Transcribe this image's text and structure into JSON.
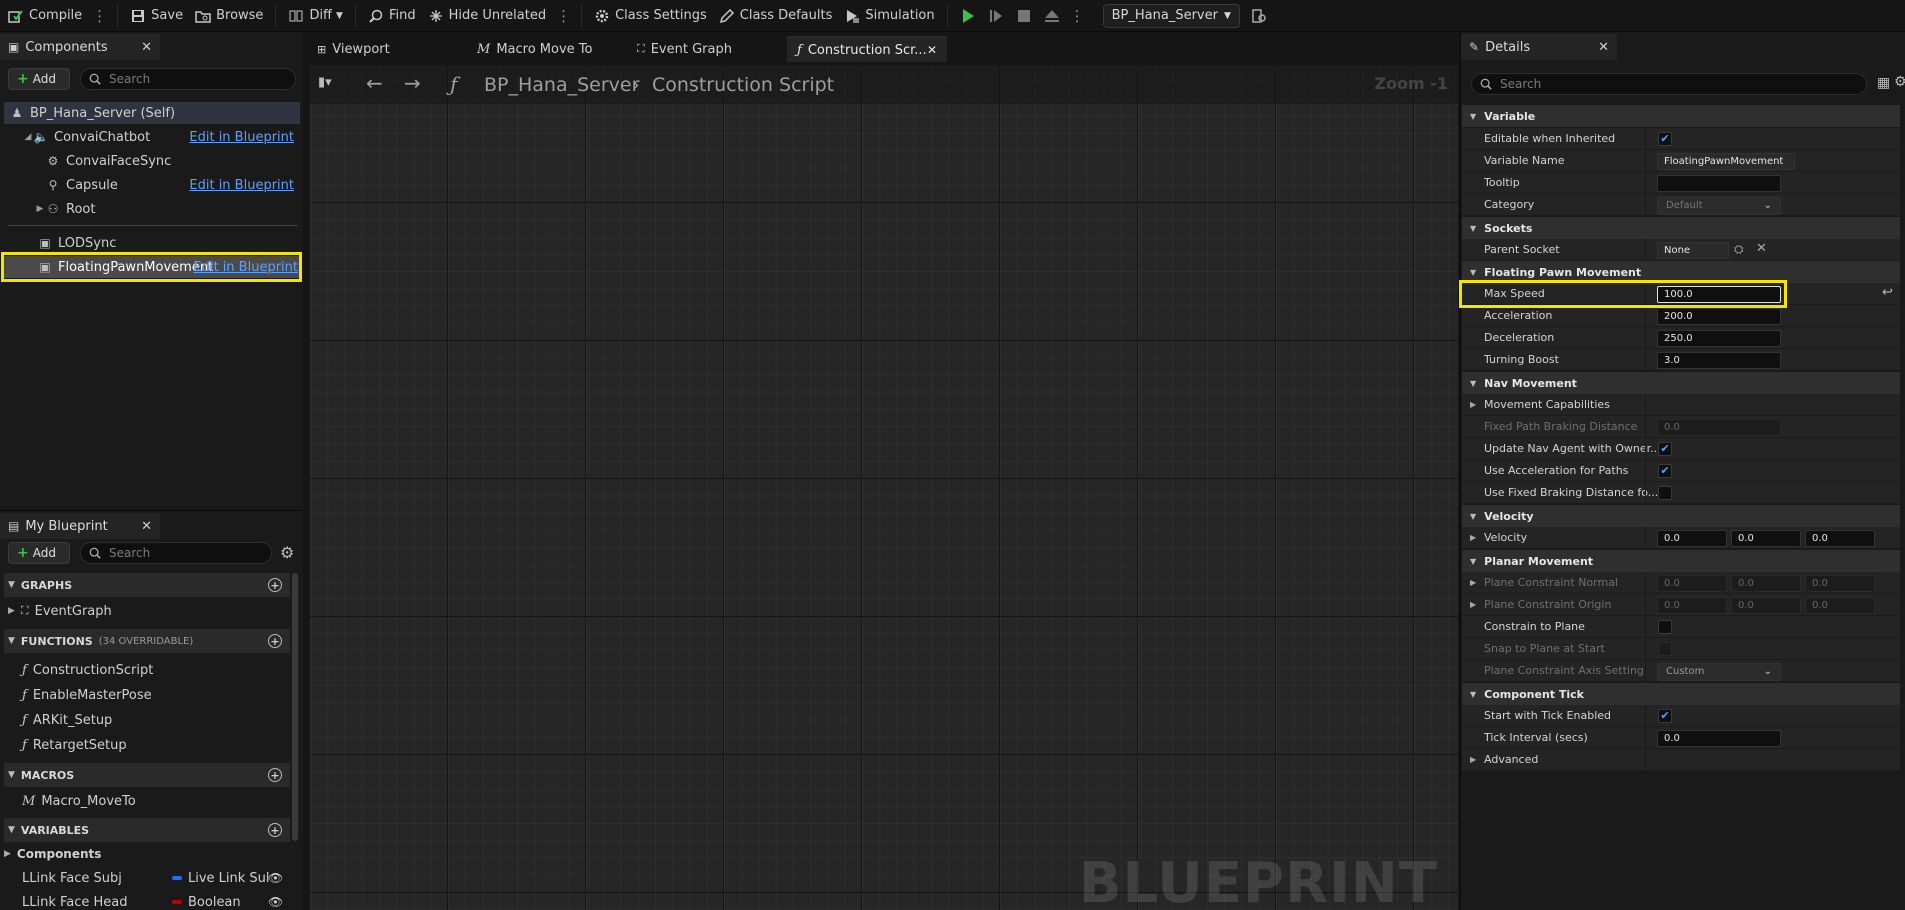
{
  "toolbar": {
    "compile": "Compile",
    "save": "Save",
    "browse": "Browse",
    "diff": "Diff",
    "find": "Find",
    "hide_unrelated": "Hide Unrelated",
    "class_settings": "Class Settings",
    "class_defaults": "Class Defaults",
    "simulation": "Simulation",
    "debug_object": "BP_Hana_Server"
  },
  "components": {
    "tab_title": "Components",
    "add_label": "Add",
    "search_placeholder": "Search",
    "edit_in_blueprint": "Edit in Blueprint",
    "items": [
      {
        "label": "BP_Hana_Server (Self)"
      },
      {
        "label": "ConvaiChatbot"
      },
      {
        "label": "ConvaiFaceSync"
      },
      {
        "label": "Capsule"
      },
      {
        "label": "Root"
      },
      {
        "label": "LODSync"
      },
      {
        "label": "FloatingPawnMovement"
      }
    ]
  },
  "my_blueprint": {
    "tab_title": "My Blueprint",
    "add_label": "Add",
    "search_placeholder": "Search",
    "graphs_header": "GRAPHS",
    "graphs": [
      "EventGraph"
    ],
    "functions_header": "FUNCTIONS",
    "functions_note": "(34 OVERRIDABLE)",
    "functions": [
      "ConstructionScript",
      "EnableMasterPose",
      "ARKit_Setup",
      "RetargetSetup"
    ],
    "macros_header": "MACROS",
    "macros": [
      "Macro_MoveTo"
    ],
    "variables_header": "VARIABLES",
    "variables_group": "Components",
    "variables": [
      {
        "name": "LLink Face Subj",
        "type": "Live Link Sul",
        "color": "#1f6fff"
      },
      {
        "name": "LLink Face Head",
        "type": "Boolean",
        "color": "#c00000"
      }
    ]
  },
  "graph": {
    "tabs": [
      {
        "label": "Viewport"
      },
      {
        "label": "Macro Move To"
      },
      {
        "label": "Event Graph"
      },
      {
        "label": "Construction Scr..."
      }
    ],
    "breadcrumb_blueprint": "BP_Hana_Server",
    "breadcrumb_graph": "Construction Script",
    "zoom": "Zoom -1",
    "watermark": "BLUEPRINT"
  },
  "details": {
    "tab_title": "Details",
    "search_placeholder": "Search",
    "sections": {
      "variable": "Variable",
      "sockets": "Sockets",
      "floating": "Floating Pawn Movement",
      "nav": "Nav Movement",
      "velocity": "Velocity",
      "planar": "Planar Movement",
      "tick": "Component Tick"
    },
    "rows": {
      "editable_inherited": "Editable when Inherited",
      "variable_name": "Variable Name",
      "variable_name_value": "FloatingPawnMovement",
      "tooltip": "Tooltip",
      "category": "Category",
      "category_value": "Default",
      "parent_socket": "Parent Socket",
      "parent_socket_value": "None",
      "max_speed": "Max Speed",
      "max_speed_value": "100.0",
      "acceleration": "Acceleration",
      "acceleration_value": "200.0",
      "deceleration": "Deceleration",
      "deceleration_value": "250.0",
      "turning_boost": "Turning Boost",
      "turning_boost_value": "3.0",
      "movement_capabilities": "Movement Capabilities",
      "fixed_path": "Fixed Path Braking Distance",
      "fixed_path_value": "0.0",
      "update_nav": "Update Nav Agent with Owner...",
      "use_accel": "Use Acceleration for Paths",
      "use_fixed": "Use Fixed Braking Distance fo...",
      "velocity": "Velocity",
      "velocity_x": "0.0",
      "velocity_y": "0.0",
      "velocity_z": "0.0",
      "plane_normal": "Plane Constraint Normal",
      "plane_origin": "Plane Constraint Origin",
      "zero": "0.0",
      "constrain_plane": "Constrain to Plane",
      "snap_plane": "Snap to Plane at Start",
      "plane_axis": "Plane Constraint Axis Setting",
      "plane_axis_value": "Custom",
      "start_tick": "Start with Tick Enabled",
      "tick_interval": "Tick Interval (secs)",
      "tick_interval_value": "0.0",
      "advanced": "Advanced"
    }
  }
}
